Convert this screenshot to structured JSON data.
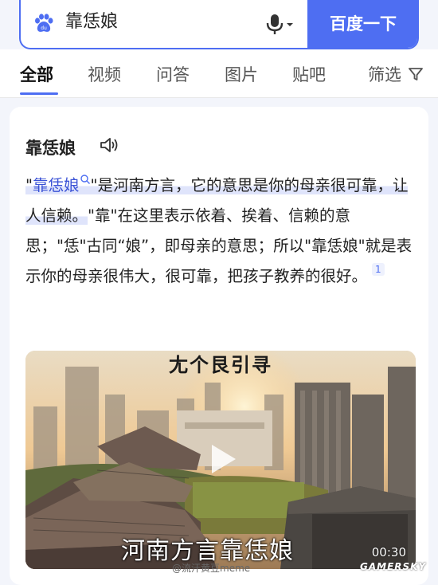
{
  "search": {
    "query": "靠恁娘",
    "button_label": "百度一下"
  },
  "tabs": [
    {
      "label": "全部",
      "active": true
    },
    {
      "label": "视频"
    },
    {
      "label": "问答"
    },
    {
      "label": "图片"
    },
    {
      "label": "贴吧"
    },
    {
      "label": "筛选"
    }
  ],
  "card": {
    "term": "靠恁娘",
    "definition": {
      "quote_open": "\"",
      "term_link": "靠恁娘",
      "part1": "\"是河南方言，它的意思是你的母亲很可靠，让人信赖。",
      "part2": "\"靠\"在这里表示依着、挨着、信赖的意思；\"恁\"古同“娘”，即母亲的意思；所以\"靠恁娘\"就是表示你的母亲很伟大，很可靠，把孩子教养的很好。",
      "ref": "1"
    },
    "video": {
      "top_text": "尢个艮引寻",
      "caption": "河南方言靠恁娘",
      "duration": "00:30"
    }
  },
  "watermarks": {
    "weibo": "@流汗黄豆meme",
    "site": "GAMERSKY"
  },
  "colors": {
    "accent": "#4e6ef2",
    "highlight": "#dfe4fb"
  }
}
